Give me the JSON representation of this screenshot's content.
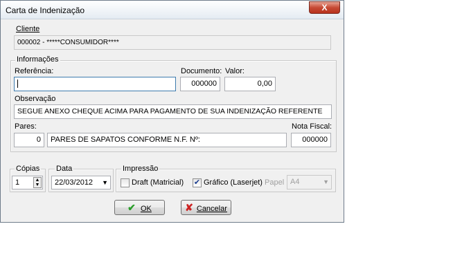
{
  "window": {
    "title": "Carta de Indenização",
    "close_glyph": "X"
  },
  "cliente": {
    "legend": "Cliente",
    "value": "000002 - *****CONSUMIDOR****"
  },
  "informacoes": {
    "legend": "Informações",
    "referencia_label": "Referência:",
    "referencia_value": "",
    "documento_label": "Documento:",
    "documento_value": "000000",
    "valor_label": "Valor:",
    "valor_value": "0,00",
    "observacao_label": "Observação",
    "observacao_value": "SEGUE ANEXO CHEQUE ACIMA PARA PAGAMENTO DE SUA INDENIZAÇÃO REFERENTE",
    "pares_label": "Pares:",
    "pares_value": "0",
    "pares_desc": "PARES DE SAPATOS CONFORME N.F. Nº:",
    "nota_label": "Nota Fiscal:",
    "nota_value": "000000"
  },
  "copias": {
    "legend": "Cópias",
    "value": "1"
  },
  "data": {
    "legend": "Data",
    "value": "22/03/2012"
  },
  "impressao": {
    "legend": "Impressão",
    "draft_label": "Draft (Matricial)",
    "draft_checked": false,
    "grafico_label": "Gráfico (Laserjet)",
    "grafico_checked": true,
    "papel_label": "Papel",
    "papel_value": "A4"
  },
  "buttons": {
    "ok_label": "OK",
    "cancel_label": "Cancelar"
  },
  "colors": {
    "ok_check": "#2a9d2a",
    "cancel_x": "#cc2222"
  }
}
